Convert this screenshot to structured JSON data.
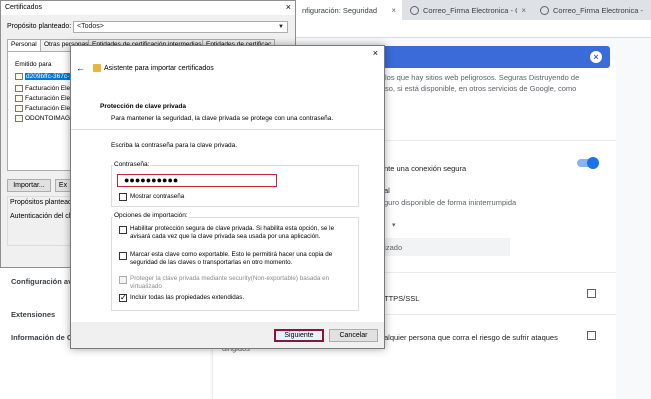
{
  "browser": {
    "tabs": [
      {
        "label": "nfiguración: Seguridad",
        "active": true
      },
      {
        "label": "Correo_Firma Electronica - Out",
        "active": false
      },
      {
        "label": "Correo_Firma Electronica - Ou",
        "active": false
      }
    ],
    "close_glyph": "×"
  },
  "settings": {
    "nav": [
      "Configuración ava",
      "Extensiones",
      "Información de C"
    ],
    "fragments": {
      "line1": "los que hay sitios web peligrosos. Seguras Distruyendo de",
      "line2": "so, si está disponible, en otros servicios de Google, como",
      "line3": "",
      "secure_conn": "nte una conexión segura",
      "al": "al",
      "uninterrupted": "guro disponible de forma ininterrumpida",
      "personalized": "onalizado",
      "https": "TTPS/SSL",
      "risk": "alquier persona que corra el riesgo de sufrir ataques",
      "dirigidos": "dirigidos"
    },
    "search_clear": "×",
    "accent": "#1a73e8"
  },
  "certificates": {
    "title": "Certificados",
    "close": "×",
    "purpose_label": "Propósito planteado:",
    "purpose_value": "<Todos>",
    "tabs": [
      "Personal",
      "Otras personas",
      "Entidades de certificación intermedias",
      "Entidades de certificac"
    ],
    "list_header": "Emitido para",
    "rows": [
      "d209bffc-367c-",
      "Facturación Ele",
      "Facturación Ele",
      "Facturación Ele",
      "ODONTOIMAGE"
    ],
    "buttons": {
      "import": "Importar...",
      "export": "Ex"
    },
    "purpose_section": "Propósitos planteado",
    "auth_label": "Autenticación del clie"
  },
  "wizard": {
    "close": "×",
    "back": "←",
    "title": "Asistente para importar certificados",
    "header_title": "Protección de clave privada",
    "header_desc": "Para mantener la seguridad, la clave privada se protege con una contraseña.",
    "prompt": "Escriba la contraseña para la clave privada.",
    "password_group": "Contraseña:",
    "password_value": "●●●●●●●●●●",
    "show_password": "Mostrar contraseña",
    "import_options_group": "Opciones de importación:",
    "options": [
      {
        "line1": "Habilitar protección segura de clave privada. Si habilita esta opción, se le",
        "line2": "avisará cada vez que la clave privada sea usada por una aplicación.",
        "checked": false,
        "disabled": false
      },
      {
        "line1": "Marcar esta clave como exportable. Esto le permitirá hacer una copia de",
        "line2": "seguridad de las claves o transportarlas en otro momento.",
        "checked": false,
        "disabled": false
      },
      {
        "line1": "Proteger la clave privada mediante security(Non-exportable) basada en",
        "line2": "virtualizado",
        "checked": false,
        "disabled": true
      },
      {
        "line1": "Incluir todas las propiedades extendidas.",
        "line2": "",
        "checked": true,
        "disabled": false
      }
    ],
    "next_button": "Siguiente",
    "cancel_button": "Cancelar",
    "highlight_color": "#c0283a"
  }
}
